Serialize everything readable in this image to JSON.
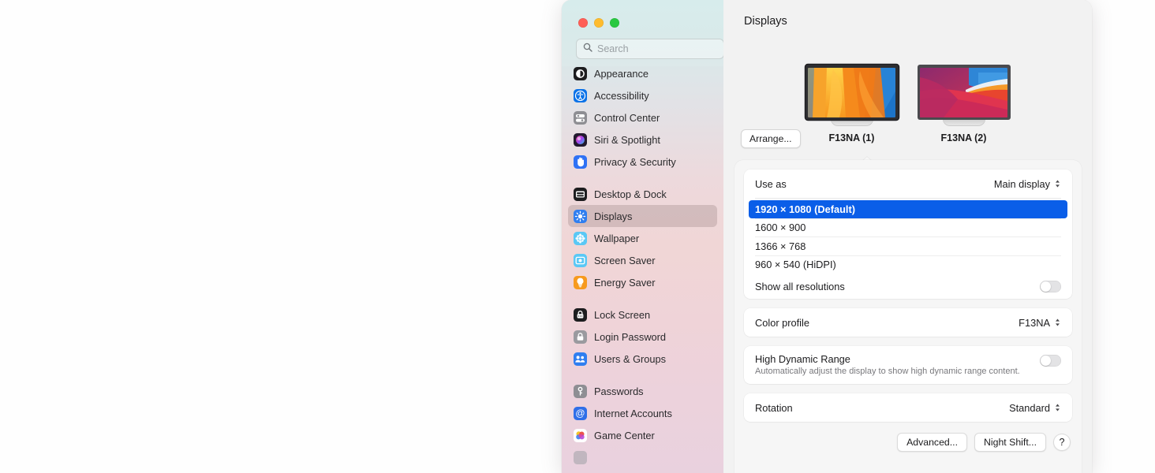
{
  "window": {
    "traffic_lights": [
      {
        "name": "close",
        "color": "#ff5f57"
      },
      {
        "name": "minimize",
        "color": "#febc2e"
      },
      {
        "name": "zoom",
        "color": "#28c840"
      }
    ]
  },
  "search": {
    "placeholder": "Search",
    "value": "",
    "icon": "search-icon"
  },
  "sidebar": {
    "groups": [
      {
        "items": [
          {
            "label": "Appearance",
            "icon": "appearance-icon",
            "selected": false
          },
          {
            "label": "Accessibility",
            "icon": "accessibility-icon",
            "selected": false
          },
          {
            "label": "Control Center",
            "icon": "control-center-icon",
            "selected": false
          },
          {
            "label": "Siri & Spotlight",
            "icon": "siri-icon",
            "selected": false
          },
          {
            "label": "Privacy & Security",
            "icon": "privacy-icon",
            "selected": false
          }
        ]
      },
      {
        "items": [
          {
            "label": "Desktop & Dock",
            "icon": "desktop-dock-icon",
            "selected": false
          },
          {
            "label": "Displays",
            "icon": "displays-icon",
            "selected": true
          },
          {
            "label": "Wallpaper",
            "icon": "wallpaper-icon",
            "selected": false
          },
          {
            "label": "Screen Saver",
            "icon": "screen-saver-icon",
            "selected": false
          },
          {
            "label": "Energy Saver",
            "icon": "energy-saver-icon",
            "selected": false
          }
        ]
      },
      {
        "items": [
          {
            "label": "Lock Screen",
            "icon": "lock-screen-icon",
            "selected": false
          },
          {
            "label": "Login Password",
            "icon": "login-password-icon",
            "selected": false
          },
          {
            "label": "Users & Groups",
            "icon": "users-groups-icon",
            "selected": false
          }
        ]
      },
      {
        "items": [
          {
            "label": "Passwords",
            "icon": "passwords-icon",
            "selected": false
          },
          {
            "label": "Internet Accounts",
            "icon": "internet-accounts-icon",
            "selected": false
          },
          {
            "label": "Game Center",
            "icon": "game-center-icon",
            "selected": false
          }
        ]
      }
    ]
  },
  "main": {
    "title": "Displays",
    "arrange_label": "Arrange...",
    "displays": [
      {
        "label": "F13NA (1)",
        "selected": true,
        "wallpaper": "ventura-orange"
      },
      {
        "label": "F13NA (2)",
        "selected": false,
        "wallpaper": "big-sur-pink"
      }
    ],
    "use_as": {
      "label": "Use as",
      "value": "Main display"
    },
    "resolutions": [
      {
        "label": "1920 × 1080 (Default)",
        "selected": true
      },
      {
        "label": "1600 × 900",
        "selected": false
      },
      {
        "label": "1366 × 768",
        "selected": false
      },
      {
        "label": "960 × 540 (HiDPI)",
        "selected": false
      }
    ],
    "show_all_resolutions": {
      "label": "Show all resolutions",
      "enabled": false
    },
    "color_profile": {
      "label": "Color profile",
      "value": "F13NA"
    },
    "hdr": {
      "label": "High Dynamic Range",
      "sublabel": "Automatically adjust the display to show high dynamic range content.",
      "enabled": false
    },
    "rotation": {
      "label": "Rotation",
      "value": "Standard"
    },
    "buttons": {
      "advanced": "Advanced...",
      "night_shift": "Night Shift...",
      "help": "?"
    }
  },
  "colors": {
    "accent": "#0a5ee8",
    "panel_bg": "#f6f6f6",
    "content_bg": "#f2f2f2"
  }
}
